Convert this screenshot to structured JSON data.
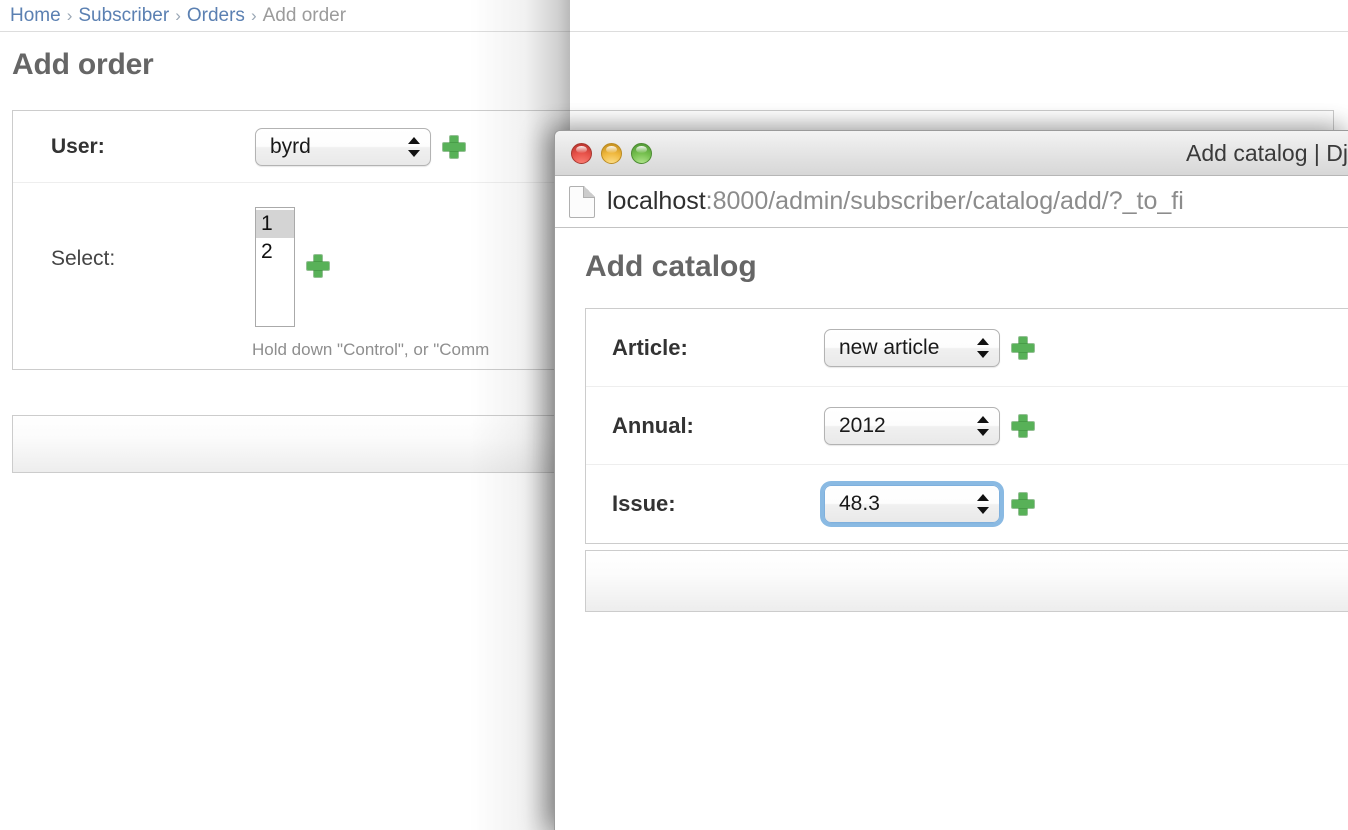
{
  "background_page": {
    "breadcrumb": {
      "items": [
        {
          "label": "Home",
          "type": "link"
        },
        {
          "label": "Subscriber",
          "type": "link"
        },
        {
          "label": "Orders",
          "type": "link"
        },
        {
          "label": "Add order",
          "type": "current"
        }
      ],
      "separator": "›"
    },
    "title": "Add order",
    "rows": [
      {
        "label": "User:",
        "control": "select",
        "value": "byrd",
        "add_icon": "add-plus-icon"
      },
      {
        "label": "Select:",
        "control": "multiselect",
        "options": [
          {
            "value": "1",
            "selected": true
          },
          {
            "value": "2",
            "selected": false
          }
        ],
        "add_icon": "add-plus-icon"
      }
    ],
    "help_text": "Hold down \"Control\", or \"Comm",
    "colors": {
      "link": "#5b80b2",
      "heading": "#666666",
      "add_icon_green": "#58b158"
    }
  },
  "popup_window": {
    "traffic_lights": [
      {
        "name": "close-button",
        "color": "#e8534a"
      },
      {
        "name": "minimize-button",
        "color": "#f0b93f"
      },
      {
        "name": "zoom-button",
        "color": "#76c04f"
      }
    ],
    "title": "Add catalog | Dj",
    "url": {
      "host": "localhost",
      "path": ":8000/admin/subscriber/catalog/add/?_to_fi",
      "icon": "document-icon"
    },
    "page_title": "Add catalog",
    "rows": [
      {
        "label": "Article:",
        "control": "select",
        "value": "new article",
        "focused": false,
        "add_icon": "add-plus-icon"
      },
      {
        "label": "Annual:",
        "control": "select",
        "value": "2012",
        "focused": false,
        "add_icon": "add-plus-icon"
      },
      {
        "label": "Issue:",
        "control": "select",
        "value": "48.3",
        "focused": true,
        "add_icon": "add-plus-icon"
      }
    ],
    "colors": {
      "focus_ring": "#76aede",
      "titlebar": "#e4e4e4"
    }
  }
}
